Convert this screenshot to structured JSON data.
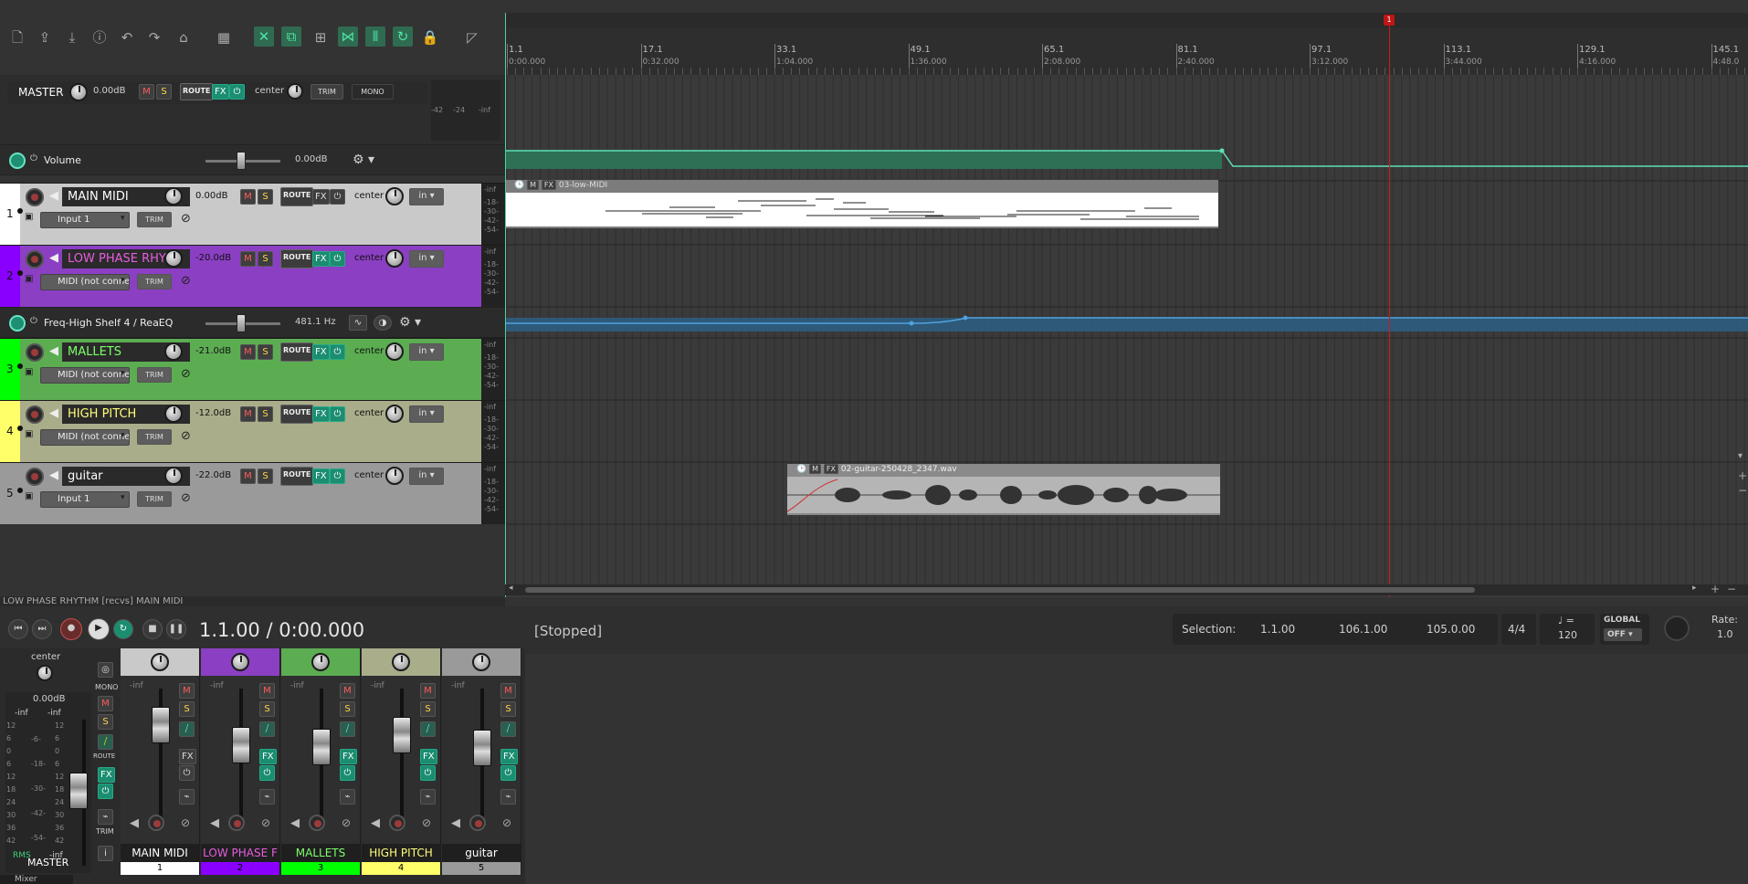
{
  "toolbar": {
    "icons": [
      "new-project-icon",
      "open-icon",
      "save-icon",
      "info-icon",
      "undo-icon",
      "redo-icon",
      "metronome-icon",
      "grid-icon",
      "ripple-icon",
      "link-icon",
      "snap-grid-icon",
      "autocrossfade-icon",
      "envelopes-icon",
      "loop-icon",
      "lock-icon"
    ]
  },
  "master": {
    "label": "MASTER",
    "volume": "0.00dB",
    "m": "M",
    "s": "S",
    "route": "ROUTE",
    "fx": "FX",
    "pan": "center",
    "trim": "TRIM",
    "mono": "MONO",
    "meter_labels": [
      "-42",
      "-24",
      "-inf"
    ]
  },
  "master_env": {
    "label": "Volume",
    "value": "0.00dB"
  },
  "tracks": [
    {
      "num": "1",
      "name": "MAIN MIDI",
      "vol": "0.00dB",
      "pan": "center",
      "input": "Input 1",
      "color": "#c9c9c9",
      "name_color": "#ffffff",
      "num_color": "#ffffff"
    },
    {
      "num": "2",
      "name": "LOW PHASE RHYT",
      "vol": "-20.0dB",
      "pan": "center",
      "input": "MIDI (not connec",
      "color": "#8b3fc3",
      "name_color": "#e85ee0",
      "num_color": "#8a00ff"
    },
    {
      "num": "3",
      "name": "MALLETS",
      "vol": "-21.0dB",
      "pan": "center",
      "input": "MIDI (not connec",
      "color": "#5cad52",
      "name_color": "#7dff6a",
      "num_color": "#00ff00"
    },
    {
      "num": "4",
      "name": "HIGH PITCH",
      "vol": "-12.0dB",
      "pan": "center",
      "input": "MIDI (not connec",
      "color": "#a9ad8a",
      "name_color": "#ffff7a",
      "num_color": "#ffff6a"
    },
    {
      "num": "5",
      "name": "guitar",
      "vol": "-22.0dB",
      "pan": "center",
      "input": "Input 1",
      "color": "#9a9a9a",
      "name_color": "#ffffff",
      "num_color": "#9a9a9a"
    }
  ],
  "track_labels": {
    "m": "M",
    "s": "S",
    "route": "ROUTE",
    "fx": "FX",
    "in": "in",
    "trim": "TRIM"
  },
  "track_meter_labels": [
    "-inf",
    "-18-",
    "-30-",
    "-42-",
    "-54-"
  ],
  "fx_env": {
    "label": "Freq-High Shelf 4 / ReaEQ",
    "value": "481.1 Hz"
  },
  "ruler": {
    "markers": [
      {
        "bar": "1.1",
        "time": "0:00.000"
      },
      {
        "bar": "17.1",
        "time": "0:32.000"
      },
      {
        "bar": "33.1",
        "time": "1:04.000"
      },
      {
        "bar": "49.1",
        "time": "1:36.000"
      },
      {
        "bar": "65.1",
        "time": "2:08.000"
      },
      {
        "bar": "81.1",
        "time": "2:40.000"
      },
      {
        "bar": "97.1",
        "time": "3:12.000"
      },
      {
        "bar": "113.1",
        "time": "3:44.000"
      },
      {
        "bar": "129.1",
        "time": "4:16.000"
      },
      {
        "bar": "145.1",
        "time": "4:48.0"
      }
    ],
    "region_marker": "1"
  },
  "items": {
    "midi_item": "03-low-MIDI",
    "audio_item": "02-guitar-250428_2347.wav",
    "item_m": "M",
    "item_fx": "FX"
  },
  "status_line": "LOW PHASE RHYTHM [recvs] MAIN MIDI",
  "transport": {
    "position": "1.1.00 / 0:00.000",
    "state": "[Stopped]",
    "selection_label": "Selection:",
    "sel_start": "1.1.00",
    "sel_end": "106.1.00",
    "sel_len": "105.0.00",
    "time_sig": "4/4",
    "tempo_symbol": "♩ =",
    "tempo": "120",
    "global_label": "GLOBAL",
    "global_value": "OFF",
    "rate_label": "Rate:",
    "rate": "1.0"
  },
  "mixer": {
    "master_pan": "center",
    "master_vol": "0.00dB",
    "master_meter_left": "-inf",
    "master_meter_right": "-inf",
    "master_scale_left": [
      "12",
      "6",
      "0",
      "6",
      "12",
      "18",
      "24",
      "30",
      "36",
      "42"
    ],
    "master_scale_mid": [
      "-6-",
      "-18-",
      "-30-",
      "-42-",
      "-54-"
    ],
    "master_scale_right": [
      "12",
      "6",
      "0",
      "6",
      "12",
      "18",
      "24",
      "30",
      "36",
      "42"
    ],
    "master_label": "MASTER",
    "rms": "RMS",
    "rms_value": "-inf",
    "mono": "MONO",
    "m": "M",
    "s": "S",
    "route": "ROUTE",
    "fx": "FX",
    "trim": "TRIM",
    "info": "i",
    "strips": [
      {
        "name": "MAIN MIDI",
        "num": "1",
        "meter": "-inf",
        "color": "#c9c9c9",
        "num_color": "#ffffff",
        "name_color": "#ffffff",
        "fader": 0.62
      },
      {
        "name": "LOW PHASE F",
        "num": "2",
        "meter": "-inf",
        "color": "#8b3fc3",
        "num_color": "#8a00ff",
        "name_color": "#e85ee0",
        "fader": 0.38
      },
      {
        "name": "MALLETS",
        "num": "3",
        "meter": "-inf",
        "color": "#5cad52",
        "num_color": "#00ff00",
        "name_color": "#7dff6a",
        "fader": 0.36
      },
      {
        "name": "HIGH PITCH",
        "num": "4",
        "meter": "-inf",
        "color": "#a9ad8a",
        "num_color": "#ffff6a",
        "name_color": "#ffff7a",
        "fader": 0.5
      },
      {
        "name": "guitar",
        "num": "5",
        "meter": "-inf",
        "color": "#9a9a9a",
        "num_color": "#9a9a9a",
        "name_color": "#ffffff",
        "fader": 0.34
      }
    ],
    "tab_label": "Mixer"
  }
}
